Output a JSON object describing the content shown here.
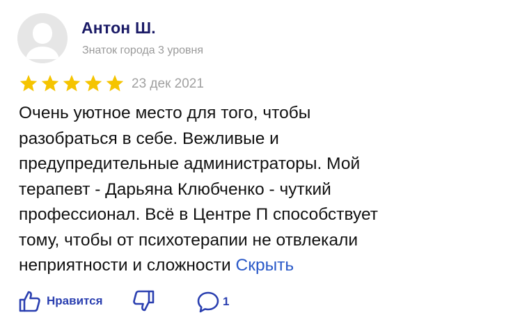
{
  "author": {
    "name": "Антон Ш.",
    "level": "Знаток города 3 уровня",
    "avatar_icon": "user-silhouette-icon"
  },
  "review": {
    "rating": 5,
    "rating_max": 5,
    "date": "23 дек 2021",
    "text_lines": [
      "Очень уютное место для того, чтобы",
      "разобраться в себе. Вежливые и",
      "предупредительные администраторы. Мой",
      "терапевт - Дарьяна Клюбченко - чуткий",
      "профессионал. Всё в Центре П способствует",
      "тому, чтобы от психотерапии не отвлекали",
      "неприятности и сложности"
    ],
    "hide_link": "Скрыть"
  },
  "actions": {
    "like_label": "Нравится",
    "like_icon": "thumbs-up-icon",
    "dislike_icon": "thumbs-down-icon",
    "comment_icon": "comment-bubble-icon",
    "comment_count": "1"
  },
  "colors": {
    "star": "#f5c400",
    "accent": "#2a3fb0",
    "link": "#2a59c8",
    "name": "#1a1a66",
    "muted": "#9a9a9a"
  }
}
